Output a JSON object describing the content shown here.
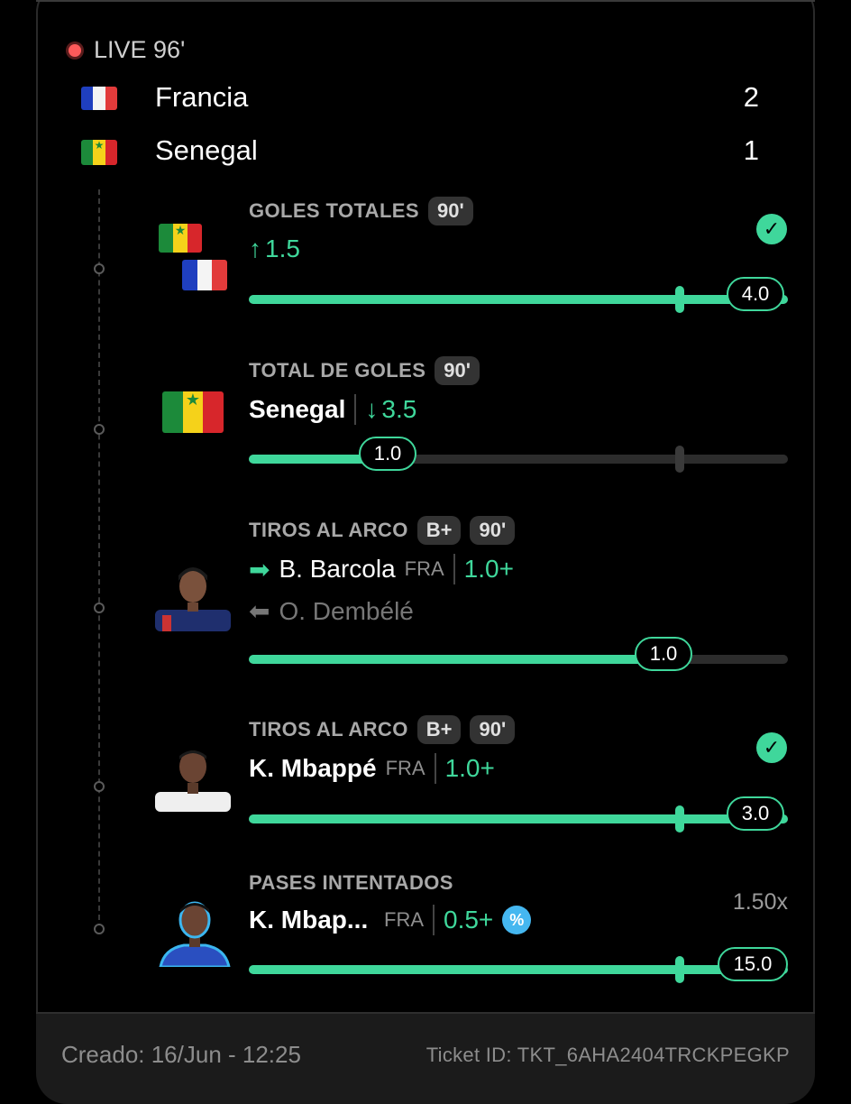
{
  "live": {
    "status": "LIVE 96'"
  },
  "teams": [
    {
      "name": "Francia",
      "score": "2",
      "flag": "france-flag"
    },
    {
      "name": "Senegal",
      "score": "1",
      "flag": "senegal-flag"
    }
  ],
  "bets": [
    {
      "market": "GOLES TOTALES",
      "chips": [
        "90'"
      ],
      "selection_arrow": "↑",
      "selection_value": "1.5",
      "target_fraction": 0.8,
      "current_value": "4.0",
      "current_fraction": 0.95,
      "status": "won"
    },
    {
      "market": "TOTAL DE GOLES",
      "chips": [
        "90'"
      ],
      "team": "Senegal",
      "selection_arrow": "↓",
      "selection_value": "3.5",
      "target_fraction": 0.8,
      "current_value": "1.0",
      "current_fraction": 0.25
    },
    {
      "market": "TIROS AL ARCO",
      "chips": [
        "B+",
        "90'"
      ],
      "player_in": "B. Barcola",
      "player_in_team": "FRA",
      "selection_value": "1.0+",
      "player_out": "O. Dembélé",
      "current_value": "1.0",
      "current_fraction": 0.77
    },
    {
      "market": "TIROS AL ARCO",
      "chips": [
        "B+",
        "90'"
      ],
      "player": "K. Mbappé",
      "player_team": "FRA",
      "selection_value": "1.0+",
      "target_fraction": 0.8,
      "current_value": "3.0",
      "current_fraction": 0.95,
      "status": "won"
    },
    {
      "market": "PASES INTENTADOS",
      "chips": [],
      "player": "K. Mbap...",
      "player_team": "FRA",
      "selection_value": "0.5+",
      "multiplier": "1.50x",
      "promo_icon": "percent-badge-icon",
      "target_fraction": 0.8,
      "current_value": "15.0",
      "current_fraction": 0.95
    }
  ],
  "footer": {
    "created": "Creado: 16/Jun - 12:25",
    "ticket": "Ticket ID: TKT_6AHA2404TRCKPEGKP"
  },
  "colors": {
    "accent": "#3fd79b",
    "live": "#ff5a5a",
    "background": "#000000",
    "footer": "#1b1b1b"
  }
}
